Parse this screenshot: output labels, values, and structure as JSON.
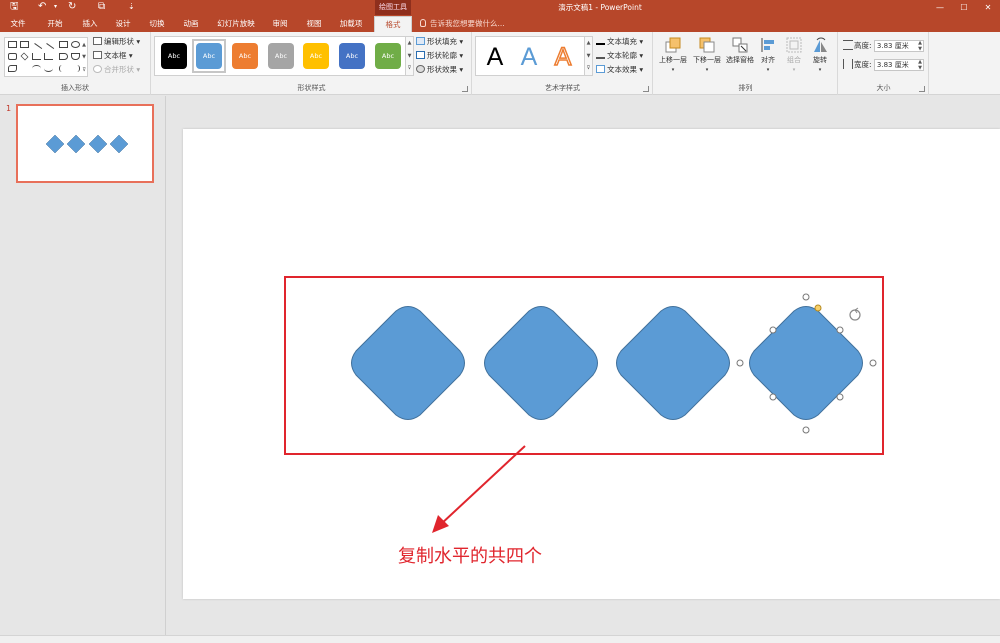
{
  "titlebar": {
    "context_group": "绘图工具",
    "window_title": "演示文稿1 - PowerPoint",
    "qa_save": "🖫",
    "qa_undo": "↶",
    "qa_redo": "↻",
    "qa_present": "⧉",
    "qa_more": "⇣"
  },
  "tabs": [
    {
      "label": "文件"
    },
    {
      "label": "开始"
    },
    {
      "label": "插入"
    },
    {
      "label": "设计"
    },
    {
      "label": "切换"
    },
    {
      "label": "动画"
    },
    {
      "label": "幻灯片放映"
    },
    {
      "label": "审阅"
    },
    {
      "label": "视图"
    },
    {
      "label": "加载项"
    },
    {
      "label": "格式"
    }
  ],
  "tell_me": "告诉我您想要做什么...",
  "ribbon": {
    "insert_shapes": {
      "label": "插入形状",
      "edit_shape": "编辑形状",
      "text_box": "文本框",
      "merge_shapes": "合并形状"
    },
    "shape_styles": {
      "label": "形状样式",
      "swatches": [
        {
          "text": "Abc",
          "color": "#000000"
        },
        {
          "text": "Abc",
          "color": "#5b9bd5"
        },
        {
          "text": "Abc",
          "color": "#ed7d31"
        },
        {
          "text": "Abc",
          "color": "#a5a5a5"
        },
        {
          "text": "Abc",
          "color": "#ffc000"
        },
        {
          "text": "Abc",
          "color": "#4472c4"
        },
        {
          "text": "Abc",
          "color": "#70ad47"
        }
      ],
      "fill": "形状填充",
      "outline": "形状轮廓",
      "effects": "形状效果"
    },
    "wordart": {
      "label": "艺术字样式",
      "letters": [
        "A",
        "A",
        "A"
      ],
      "text_fill": "文本填充",
      "text_outline": "文本轮廓",
      "text_effects": "文本效果"
    },
    "arrange": {
      "label": "排列",
      "bring_forward": "上移一层",
      "send_backward": "下移一层",
      "selection_pane": "选择窗格",
      "align": "对齐",
      "group": "组合",
      "rotate": "旋转"
    },
    "size": {
      "label": "大小",
      "height_label": "高度:",
      "height_value": "3.83 厘米",
      "width_label": "宽度:",
      "width_value": "3.83 厘米"
    }
  },
  "thumbnails": {
    "slide_number": "1"
  },
  "slide": {
    "annotation": "复制水平的共四个"
  },
  "colors": {
    "accent": "#b7472a",
    "shape_fill": "#5b9bd5",
    "shape_stroke": "#41719c",
    "annotation_red": "#e0252d"
  }
}
